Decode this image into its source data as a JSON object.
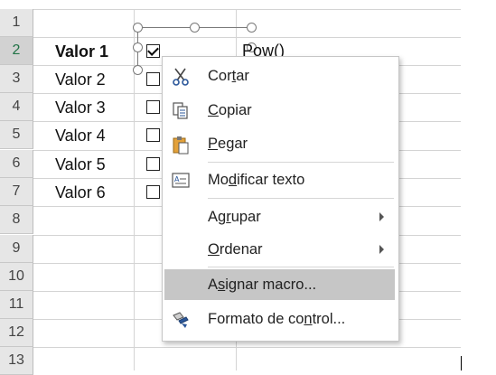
{
  "row_numbers": [
    "1",
    "2",
    "3",
    "4",
    "5",
    "6",
    "7",
    "8",
    "9",
    "10",
    "11",
    "12",
    "13"
  ],
  "labels": [
    "Valor 1",
    "Valor 2",
    "Valor 3",
    "Valor 4",
    "Valor 5",
    "Valor 6"
  ],
  "checkboxes": [
    true,
    false,
    false,
    false,
    false,
    false
  ],
  "formula_text": "Pow()",
  "menu": {
    "cut": {
      "pre": "Cor",
      "key": "t",
      "post": "ar"
    },
    "copy": {
      "pre": "",
      "key": "C",
      "post": "opiar"
    },
    "paste": {
      "pre": "",
      "key": "P",
      "post": "egar"
    },
    "edit_text": {
      "pre": "Mo",
      "key": "d",
      "post": "ificar texto"
    },
    "group": {
      "pre": "Ag",
      "key": "r",
      "post": "upar"
    },
    "order": {
      "pre": "",
      "key": "O",
      "post": "rdenar"
    },
    "assign_macro": {
      "pre": "A",
      "key": "s",
      "post": "ignar macro..."
    },
    "format_control": {
      "pre": "Formato de co",
      "key": "n",
      "post": "trol..."
    }
  },
  "colors": {
    "highlight": "#c6c6c6",
    "header_bg": "#e6e6e6"
  }
}
